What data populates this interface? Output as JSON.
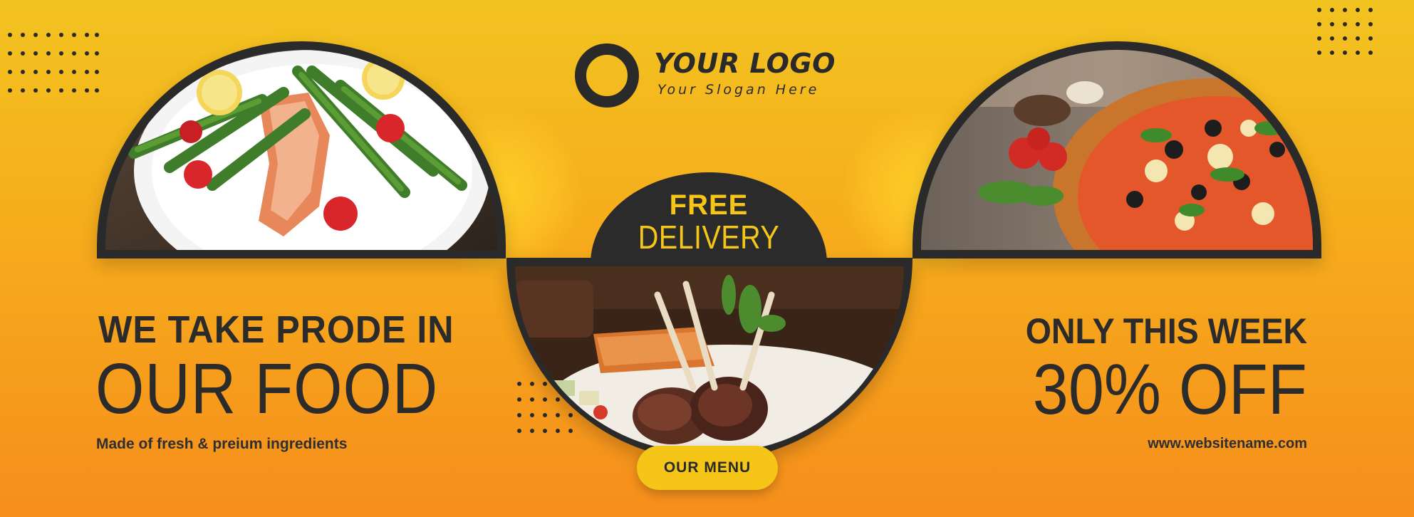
{
  "logo": {
    "title": "YOUR LOGO",
    "slogan": "Your Slogan Here",
    "icon": "ring-icon"
  },
  "badge": {
    "line1": "FREE",
    "line2": "DELIVERY"
  },
  "menu_button": {
    "label": "OUR MENU"
  },
  "left_promo": {
    "headline": "WE TAKE PRODE IN",
    "big": "OUR FOOD",
    "subtext": "Made of fresh & preium ingredients"
  },
  "right_promo": {
    "headline": "ONLY THIS WEEK",
    "big": "30% OFF",
    "website": "www.websitename.com"
  },
  "images": {
    "left": "salmon-asparagus-plate",
    "center": "lamb-chops-salmon-dish",
    "right": "pizza-on-wood-board"
  },
  "colors": {
    "accent": "#f5c518",
    "dark": "#2a2a2a",
    "bg_top": "#f2c320",
    "bg_bottom": "#f68e1c"
  }
}
